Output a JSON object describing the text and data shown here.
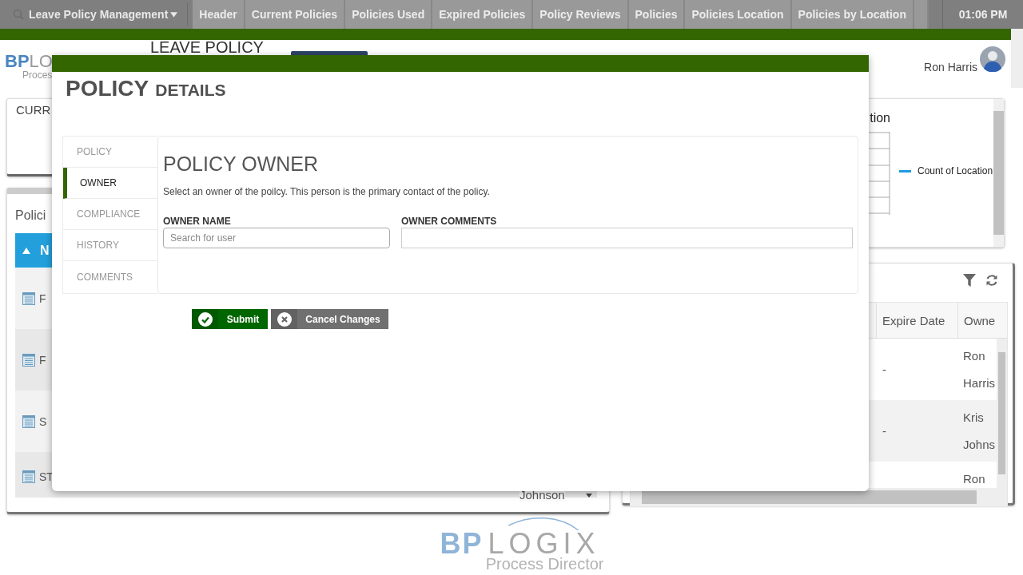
{
  "nav": {
    "app_menu": "Leave Policy Management",
    "tabs": [
      "Header",
      "Current Policies",
      "Policies Used",
      "Expired Policies",
      "Policy Reviews",
      "Policies",
      "Policies Location",
      "Policies by Location"
    ],
    "time": "01:06 PM"
  },
  "header": {
    "logo_mark": "BP",
    "logo_word": "LO",
    "logo_tagline": "Proces",
    "title": "LEAVE POLICY",
    "user": "Ron Harris"
  },
  "current_card": {
    "title": "CURR"
  },
  "policies_panel": {
    "title": "Polici",
    "sort_column": "N",
    "rows": [
      {
        "name": "F"
      },
      {
        "name": "F"
      },
      {
        "name": "S"
      },
      {
        "name": "ST",
        "owner": "Johnson"
      }
    ]
  },
  "chart_card": {
    "title": "tion",
    "legend": "Count of Location"
  },
  "policies_table": {
    "columns": [
      "Expire Date",
      "Owne"
    ],
    "rows": [
      {
        "expire": "-",
        "owner": "Ron Harris"
      },
      {
        "expire": "-",
        "owner": "Kris Johns"
      },
      {
        "expire": "",
        "owner": "Ron"
      }
    ]
  },
  "modal": {
    "title_main": "POLICY",
    "title_sub": "DETAILS",
    "tabs": [
      {
        "label": "POLICY",
        "selected": false
      },
      {
        "label": "OWNER",
        "selected": true
      },
      {
        "label": "COMPLIANCE",
        "selected": false
      },
      {
        "label": "HISTORY",
        "selected": false
      },
      {
        "label": "COMMENTS",
        "selected": false
      }
    ],
    "heading": "POLICY OWNER",
    "description": "Select an owner of the poilcy. This person is the primary contact of the policy.",
    "fields": [
      {
        "label": "OWNER NAME",
        "placeholder": "Search for user"
      },
      {
        "label": "OWNER COMMENTS"
      }
    ],
    "buttons": [
      {
        "kind": "submit",
        "label": "Submit"
      },
      {
        "kind": "cancel",
        "label": "Cancel Changes"
      }
    ]
  },
  "footer_logo": {
    "mark": "BP",
    "word": "LOGIX",
    "tagline": "Process Director"
  }
}
